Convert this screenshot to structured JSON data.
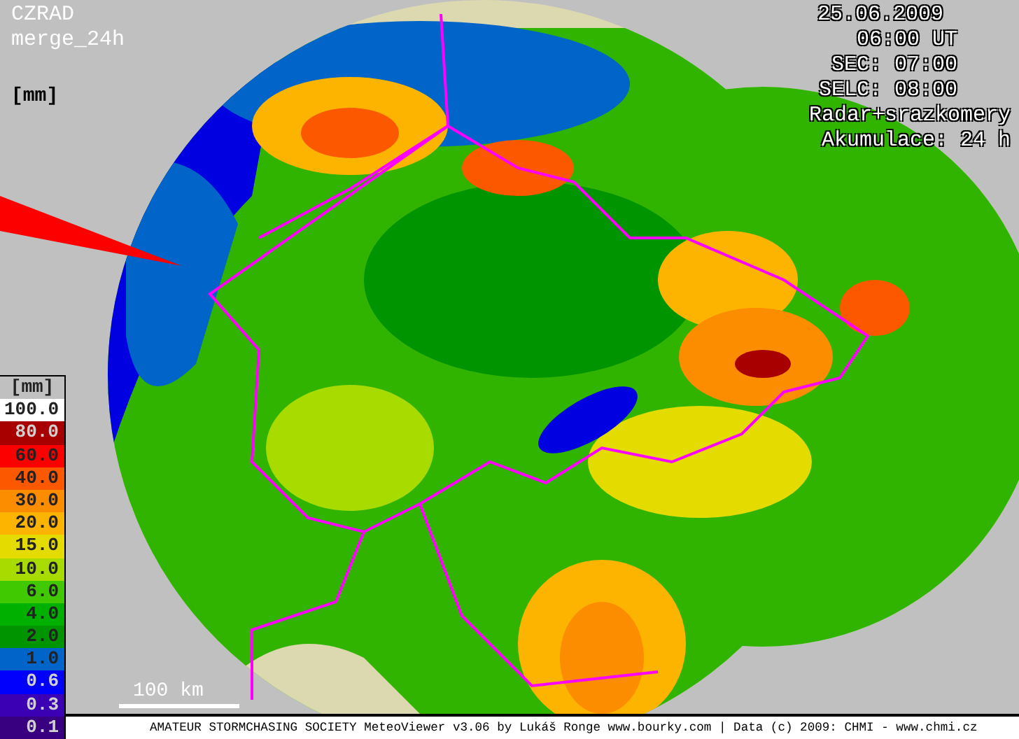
{
  "product": {
    "name": "CZRAD",
    "type": "merge_24h",
    "unit": "[mm]"
  },
  "info": {
    "date": "25.06.2009",
    "time": "06:00 UT",
    "sec": "SEC: 07:00",
    "selc": "SELC: 08:00",
    "source": "Radar+srazkomery",
    "accumulation": "Akumulace: 24 h"
  },
  "legend": {
    "title": "[mm]",
    "items": [
      {
        "label": "100.0",
        "color": "#ffffff"
      },
      {
        "label": "80.0",
        "color": "#a80000"
      },
      {
        "label": "60.0",
        "color": "#fc0000"
      },
      {
        "label": "40.0",
        "color": "#fc5800"
      },
      {
        "label": "30.0",
        "color": "#fc8c00"
      },
      {
        "label": "20.0",
        "color": "#fcb400"
      },
      {
        "label": "15.0",
        "color": "#e4dc00"
      },
      {
        "label": "10.0",
        "color": "#a8dc00"
      },
      {
        "label": "6.0",
        "color": "#40c800"
      },
      {
        "label": "4.0",
        "color": "#00b000"
      },
      {
        "label": "2.0",
        "color": "#009400"
      },
      {
        "label": "1.0",
        "color": "#0064c8"
      },
      {
        "label": "0.6",
        "color": "#0000fc"
      },
      {
        "label": "0.3",
        "color": "#3c00b4"
      },
      {
        "label": "0.1",
        "color": "#380080"
      }
    ]
  },
  "scale": {
    "label": "100 km"
  },
  "footer": "AMATEUR STORMCHASING SOCIETY MeteoViewer v3.06 by Lukáš Ronge www.bourky.com | Data (c) 2009: CHMI - www.chmi.cz"
}
